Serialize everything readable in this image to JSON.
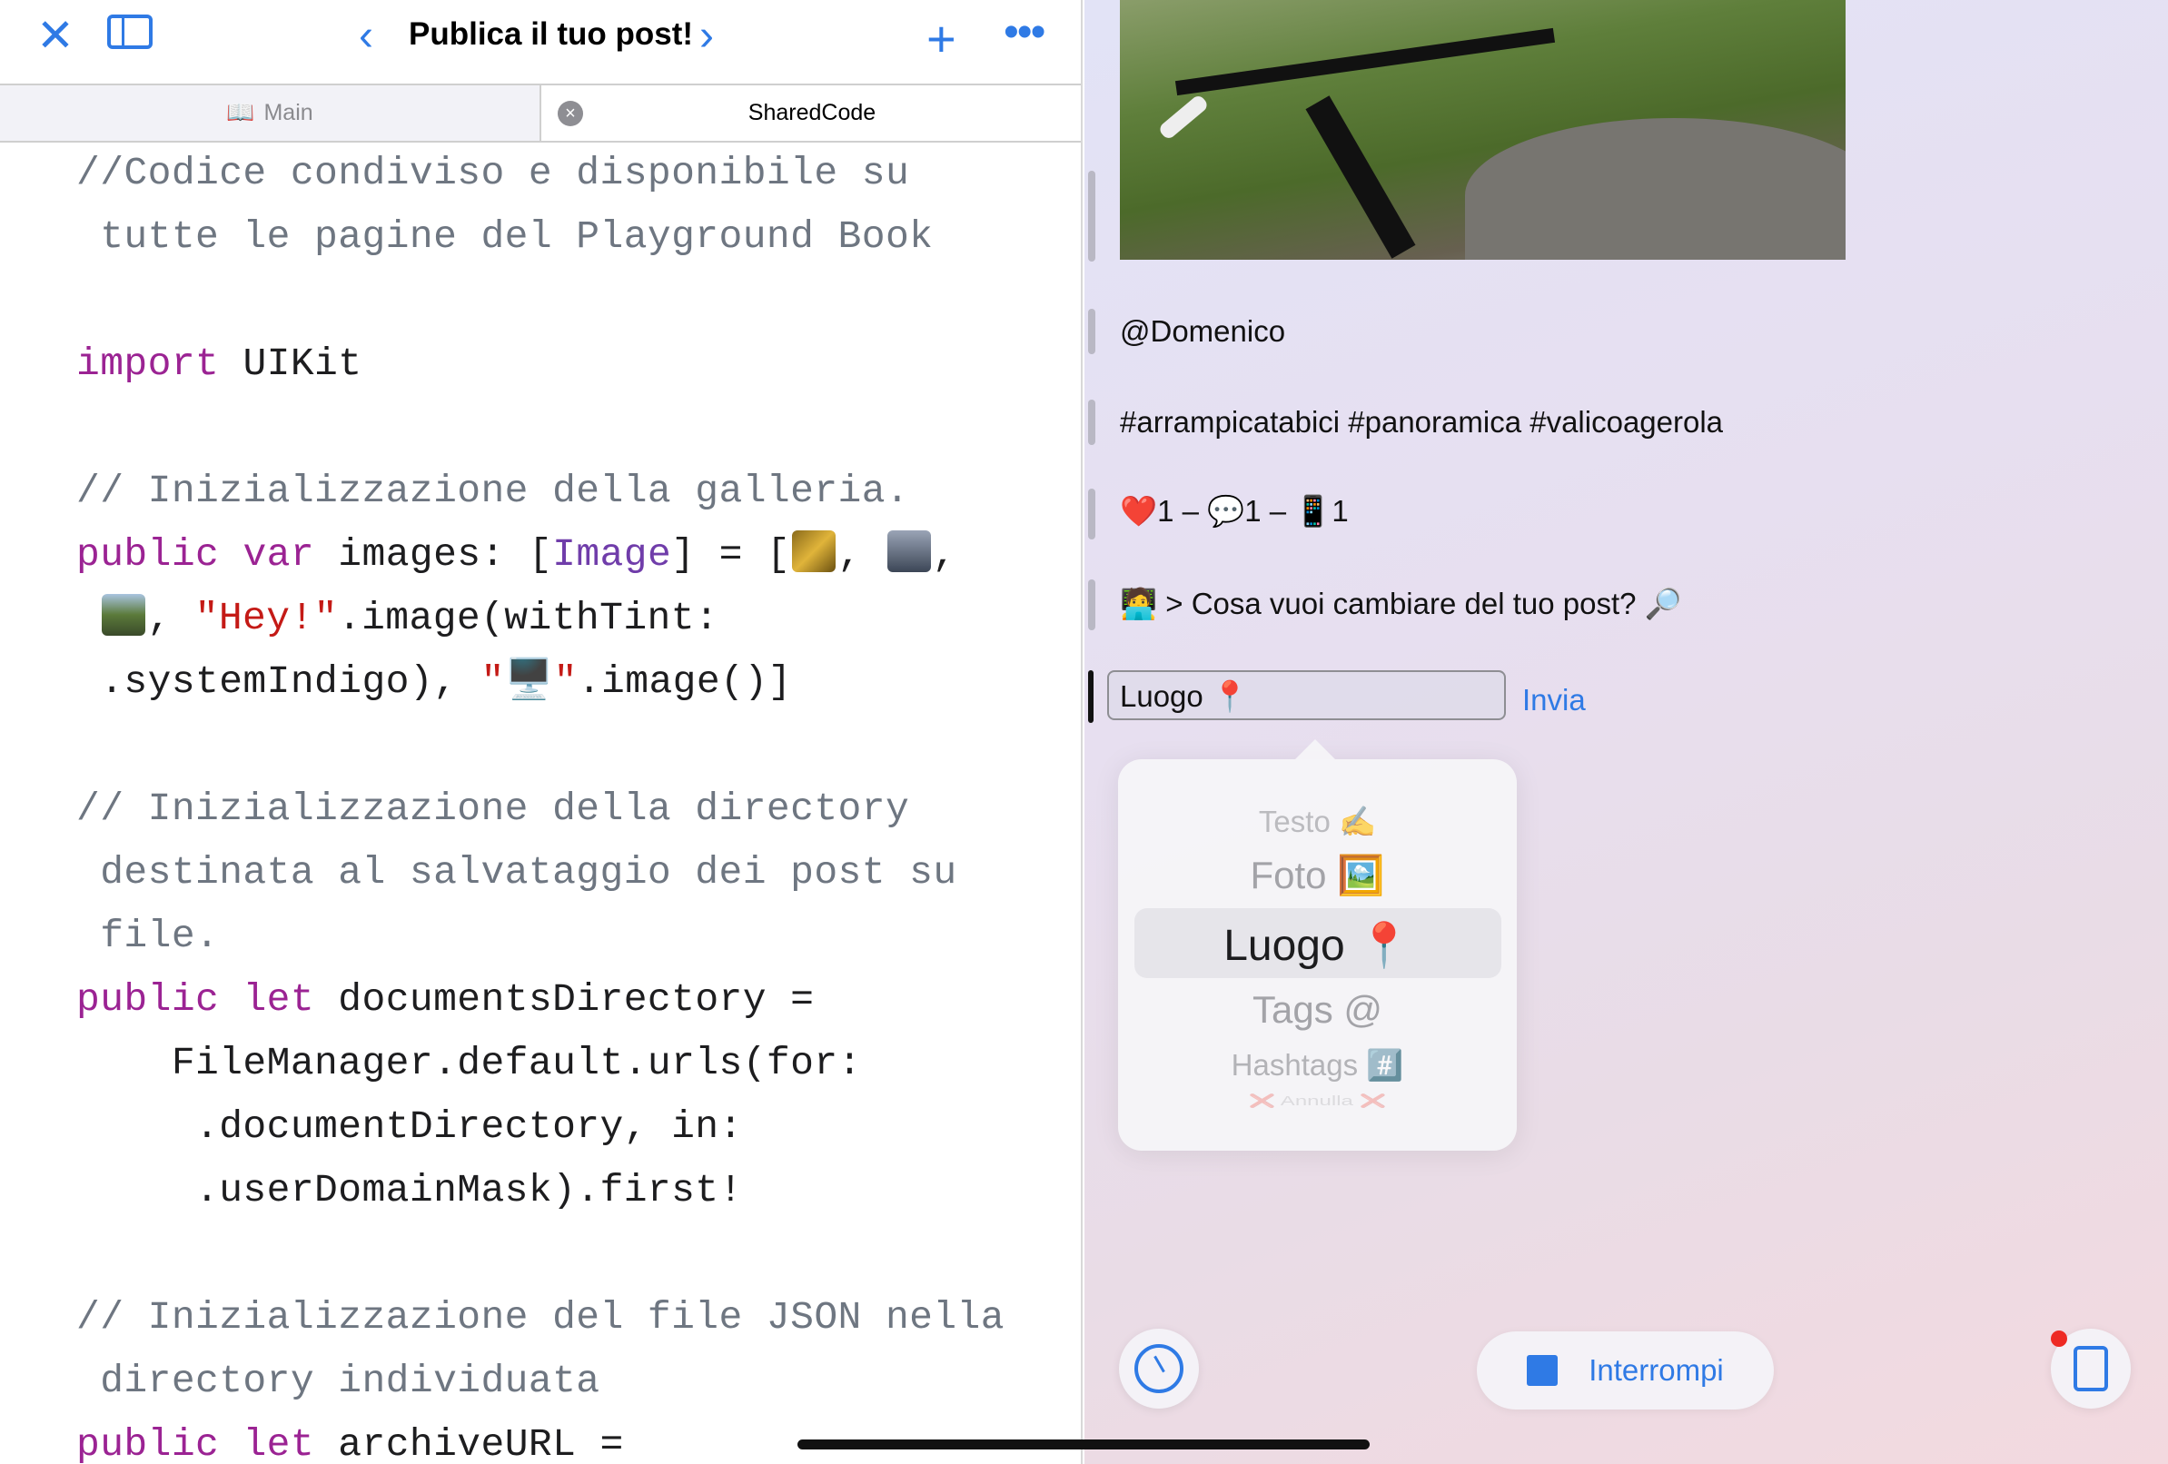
{
  "header": {
    "title": "Publica il tuo post!"
  },
  "tabs": [
    {
      "label": "Main"
    },
    {
      "label": "SharedCode"
    }
  ],
  "code": {
    "lines": [
      [
        [
          "//Codice condiviso e disponibile su",
          "c"
        ]
      ],
      [
        [
          " tutte le pagine del Playground Book",
          "c"
        ]
      ],
      [],
      [
        [
          "import",
          "k"
        ],
        [
          " UIKit",
          ""
        ]
      ],
      [],
      [
        [
          "// Inizializzazione della galleria.",
          "c"
        ]
      ],
      [
        [
          "public",
          "k"
        ],
        [
          " ",
          ""
        ],
        [
          "var",
          "k"
        ],
        [
          " images: [",
          ""
        ],
        [
          "Image",
          "t"
        ],
        [
          "] = [",
          ""
        ],
        [
          "img:yellow",
          "img"
        ],
        [
          ", ",
          ""
        ],
        [
          "img:gray",
          "img"
        ],
        [
          ",",
          ""
        ]
      ],
      [
        [
          " ",
          ""
        ],
        [
          "img:green",
          "img"
        ],
        [
          ", ",
          ""
        ],
        [
          "\"Hey!\"",
          "s"
        ],
        [
          ".image(withTint:",
          ""
        ]
      ],
      [
        [
          " .systemIndigo), ",
          ""
        ],
        [
          "\"🖥️\"",
          "s"
        ],
        [
          ".image()]",
          ""
        ]
      ],
      [],
      [
        [
          "// Inizializzazione della directory",
          "c"
        ]
      ],
      [
        [
          " destinata al salvataggio dei post su",
          "c"
        ]
      ],
      [
        [
          " file.",
          "c"
        ]
      ],
      [
        [
          "public",
          "k"
        ],
        [
          " ",
          ""
        ],
        [
          "let",
          "k"
        ],
        [
          " documentsDirectory =",
          ""
        ]
      ],
      [
        [
          "    FileManager.default.urls(for:",
          ""
        ]
      ],
      [
        [
          "     .documentDirectory, in:",
          ""
        ]
      ],
      [
        [
          "     .userDomainMask).first!",
          ""
        ]
      ],
      [],
      [
        [
          "// Inizializzazione del file JSON nella",
          "c"
        ]
      ],
      [
        [
          " directory individuata",
          "c"
        ]
      ],
      [
        [
          "public",
          "k"
        ],
        [
          " ",
          ""
        ],
        [
          "let",
          "k"
        ],
        [
          " archiveURL =",
          ""
        ]
      ]
    ]
  },
  "post": {
    "author": "@Domenico",
    "hashtags": "#arrampicatabici #panoramica #valicoagerola",
    "stats": "❤️1 – 💬1 – 📱1",
    "prompt": "🧑‍💻 > Cosa vuoi cambiare del tuo post? 🔎",
    "input_value": "Luogo 📍",
    "send_label": "Invia"
  },
  "picker": {
    "options": [
      "Testo ✍️",
      "Foto 🖼️",
      "Luogo 📍",
      "Tags @",
      "Hashtags #️⃣",
      "❌ Annulla ❌"
    ],
    "selected": "Luogo 📍"
  },
  "controls": {
    "stop_label": "Interrompi"
  },
  "colors": {
    "accent": "#2f7ae5",
    "keyword": "#9b2393",
    "string": "#c41a16",
    "comment": "#6e7681"
  }
}
